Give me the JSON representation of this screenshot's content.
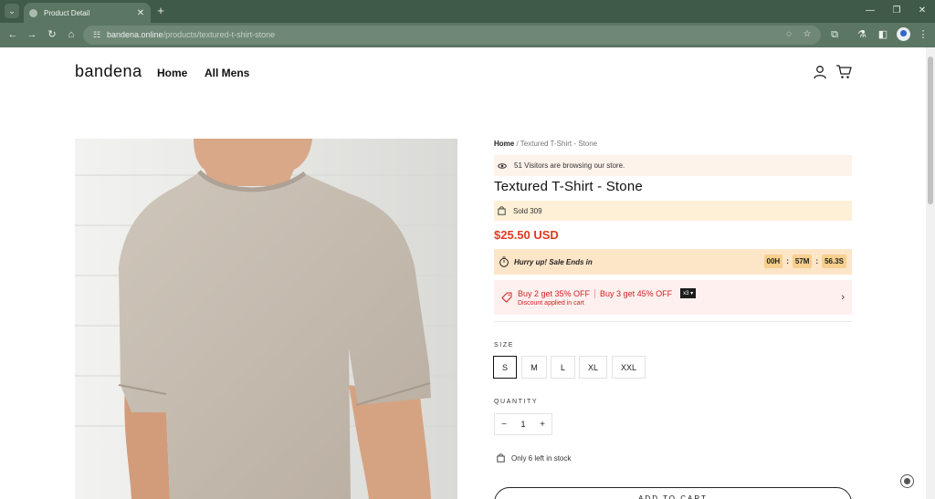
{
  "browser": {
    "tab_title": "Product Detail",
    "url_domain": "bandena.online",
    "url_path": "/products/textured-t-shirt-stone",
    "theme_color": "#3f5a46"
  },
  "site": {
    "logo": "bandena",
    "nav": [
      "Home",
      "All Mens"
    ]
  },
  "product": {
    "breadcrumb_home": "Home",
    "breadcrumb_sep": "/",
    "breadcrumb_current": "Textured T-Shirt - Stone",
    "visitors_text": "51 Visitors are browsing our store.",
    "title": "Textured T-Shirt - Stone",
    "sold_text": "Sold 309",
    "price": "$25.50 USD",
    "price_color": "#e03a1e",
    "hurry_text": "Hurry up! Sale Ends in",
    "timer": {
      "hours": "00H",
      "minutes": "57M",
      "seconds": "56.3S",
      "sep": ":"
    },
    "discount": {
      "offer1": "Buy 2 get 35% OFF",
      "offer2": "Buy 3 get 45% OFF",
      "badge": "x3 ▾",
      "applied": "Discount applied in cart"
    },
    "size_label": "SIZE",
    "sizes": [
      "S",
      "M",
      "L",
      "XL",
      "XXL"
    ],
    "selected_size": "S",
    "quantity_label": "QUANTITY",
    "quantity": "1",
    "qty_minus": "−",
    "qty_plus": "+",
    "stock_text": "Only 6 left in stock",
    "add_to_cart": "ADD TO CART"
  }
}
